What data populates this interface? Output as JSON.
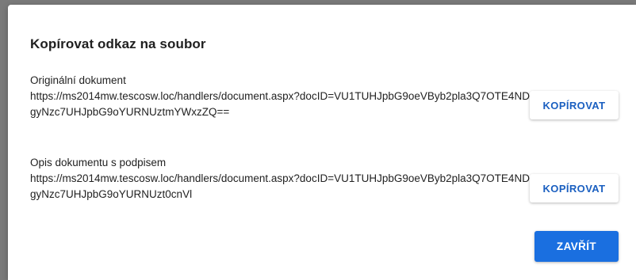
{
  "dialog": {
    "title": "Kopírovat odkaz na soubor",
    "links": [
      {
        "label": "Originální dokument",
        "url": "https://ms2014mw.tescosw.loc/handlers/document.aspx?docID=VU1TUHJpbG9oeVByb2pla3Q7OTE4NDgyNzc7UHJpbG9oYURNUztmYWxzZQ==",
        "copy_label": "KOPÍROVAT"
      },
      {
        "label": "Opis dokumentu s podpisem",
        "url": "https://ms2014mw.tescosw.loc/handlers/document.aspx?docID=VU1TUHJpbG9oeVByb2pla3Q7OTE4NDgyNzc7UHJpbG9oYURNUzt0cnVl",
        "copy_label": "KOPÍROVAT"
      }
    ],
    "close_label": "ZAVŘÍT"
  },
  "colors": {
    "backdrop": "#7a7a7a",
    "primary": "#1a6fe0",
    "link_button_text": "#1a5fc0"
  }
}
